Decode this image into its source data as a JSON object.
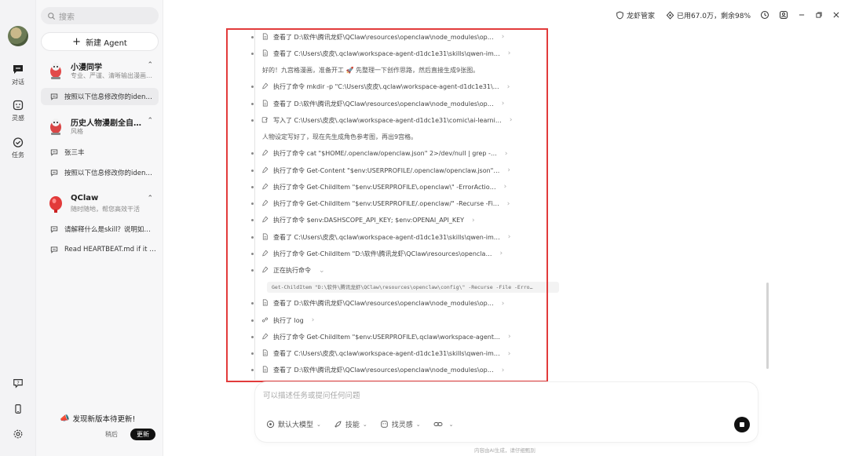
{
  "sidebar": {
    "search_placeholder": "搜索",
    "new_agent": "新建 Agent",
    "agents": [
      {
        "name": "小漫同学",
        "desc": "专业、严谨、清晰输出漫画…",
        "chevron": "⌃"
      },
      {
        "name": "历史人物漫剧全自…",
        "desc": "风格",
        "chevron": "⌃"
      },
      {
        "name": "QClaw",
        "desc": "随时随地，帮您高效干活",
        "chevron": "⌃"
      }
    ],
    "conversations": [
      "按照以下信息修改你的iden…",
      "张三丰",
      "按照以下信息修改你的iden…",
      "请解释什么是skill？说明如…",
      "Read HEARTBEAT.md if it …"
    ],
    "update": {
      "title": "发现新版本待更新!",
      "later": "稍后",
      "button": "更新"
    }
  },
  "rail": {
    "items": [
      {
        "label": "对话",
        "icon": "chat-icon"
      },
      {
        "label": "灵感",
        "icon": "inspiration-icon"
      },
      {
        "label": "任务",
        "icon": "task-icon"
      }
    ]
  },
  "topbar": {
    "manager": "龙虾管家",
    "usage": "已用67.0万，剩余98%"
  },
  "log": {
    "rows": [
      {
        "icon": "file-icon",
        "text": "查看了 D:\\软件\\腾讯龙虾\\QClaw\\resources\\openclaw\\node_modules\\op…"
      },
      {
        "icon": "file-icon",
        "text": "查看了 C:\\Users\\皮皮\\.qclaw\\workspace-agent-d1dc1e31\\skills\\qwen-im…"
      },
      {
        "plain": true,
        "text": "好的！九宫格漫画，准备开工 🚀 先整理一下创作思路，然后直接生成9张图。"
      },
      {
        "icon": "command-icon",
        "text": "执行了命令 mkdir -p \"C:\\Users\\皮皮\\.qclaw\\workspace-agent-d1dc1e31\\…"
      },
      {
        "icon": "file-icon",
        "text": "查看了 D:\\软件\\腾讯龙虾\\QClaw\\resources\\openclaw\\node_modules\\op…"
      },
      {
        "icon": "edit-icon",
        "text": "写入了 C:\\Users\\皮皮\\.qclaw\\workspace-agent-d1dc1e31\\comic\\ai-learni…"
      },
      {
        "plain": true,
        "text": "人物设定写好了，现在先生成角色参考图，再出9宫格。"
      },
      {
        "icon": "command-icon",
        "text": "执行了命令 cat \"$HOME/.openclaw/openclaw.json\" 2>/dev/null | grep -…"
      },
      {
        "icon": "command-icon",
        "text": "执行了命令 Get-Content \"$env:USERPROFILE/.openclaw/openclaw.json\"…"
      },
      {
        "icon": "command-icon",
        "text": "执行了命令 Get-ChildItem \"$env:USERPROFILE\\.openclaw\\\" -ErrorActio…"
      },
      {
        "icon": "command-icon",
        "text": "执行了命令 Get-ChildItem \"$env:USERPROFILE/.openclaw/\" -Recurse -Fi…"
      },
      {
        "icon": "command-icon",
        "text": "执行了命令 $env:DASHSCOPE_API_KEY; $env:OPENAI_API_KEY"
      },
      {
        "icon": "file-icon",
        "text": "查看了 C:\\Users\\皮皮\\.qclaw\\workspace-agent-d1dc1e31\\skills\\qwen-im…"
      },
      {
        "icon": "command-icon",
        "text": "执行了命令 Get-ChildItem \"D:\\软件\\腾讯龙虾\\QClaw\\resources\\opencla…"
      },
      {
        "icon": "command-icon",
        "text": "正在执行命令",
        "running": true
      },
      {
        "icon": "file-icon",
        "text": "查看了 D:\\软件\\腾讯龙虾\\QClaw\\resources\\openclaw\\node_modules\\op…"
      },
      {
        "icon": "log-icon",
        "text": "执行了 log"
      },
      {
        "icon": "command-icon",
        "text": "执行了命令 Get-ChildItem \"$env:USERPROFILE\\.qclaw\\workspace-agent…"
      },
      {
        "icon": "file-icon",
        "text": "查看了 C:\\Users\\皮皮\\.qclaw\\workspace-agent-d1dc1e31\\skills\\qwen-im…"
      },
      {
        "icon": "file-icon",
        "text": "查看了 D:\\软件\\腾讯龙虾\\QClaw\\resources\\openclaw\\node_modules\\op…"
      }
    ],
    "running_command": "Get-ChildItem \"D:\\软件\\腾讯龙虾\\QClaw\\resources\\openclaw\\config\\\" -Recurse -File -Erro…"
  },
  "input": {
    "placeholder": "可以描述任务或提问任何问题",
    "model": "默认大模型",
    "skills": "技能",
    "inspiration": "找灵感"
  },
  "footer_note": "内容由AI生成，请仔细甄别"
}
